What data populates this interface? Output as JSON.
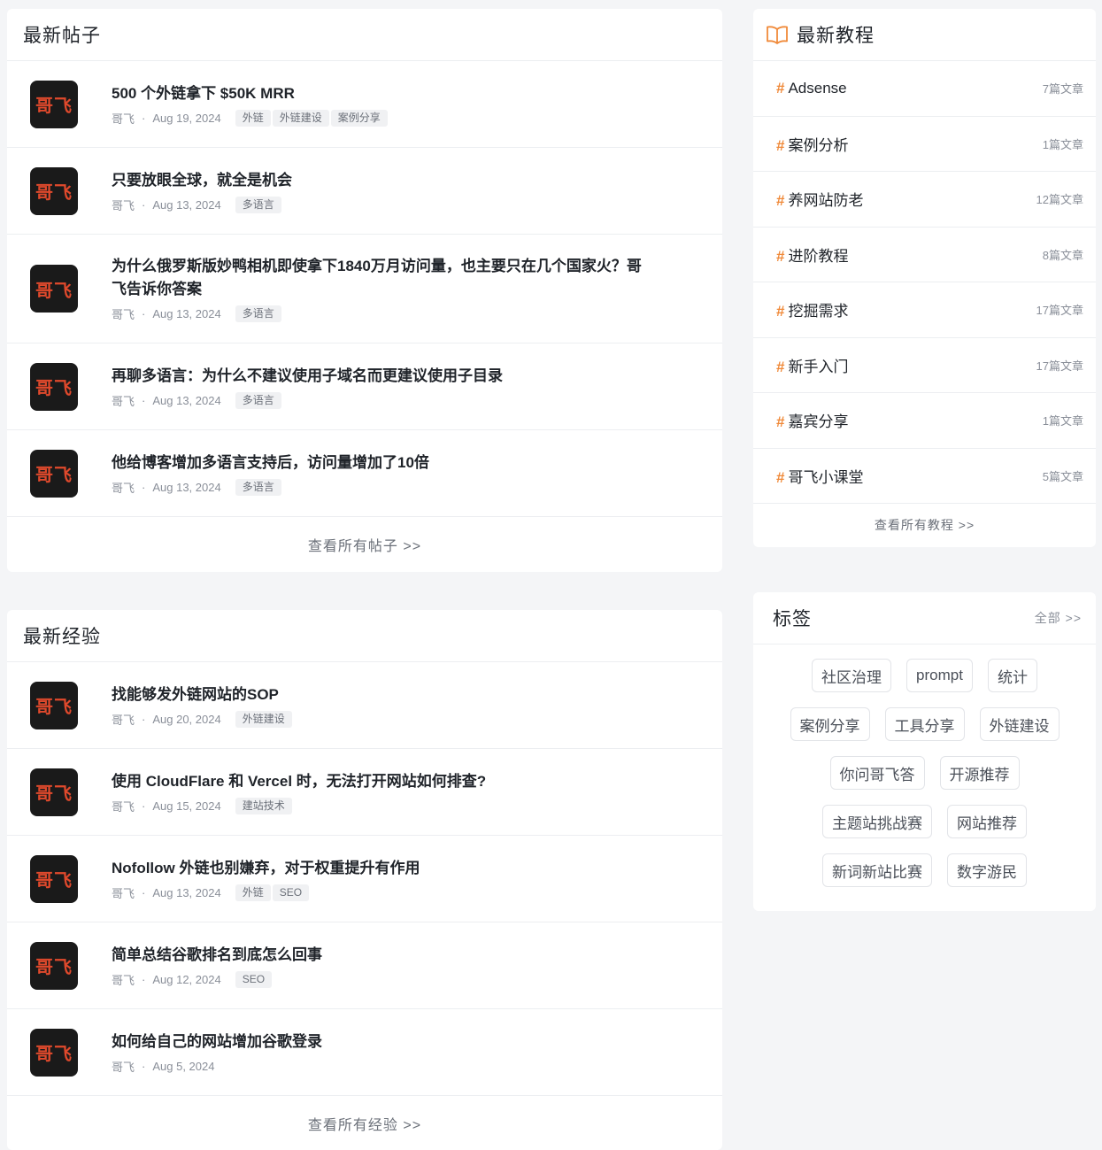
{
  "latest_posts": {
    "title": "最新帖子",
    "see_all": "查看所有帖子 >>",
    "items": [
      {
        "avatar": "哥飞",
        "title": "500 个外链拿下 $50K MRR",
        "author": "哥飞",
        "date": "Aug 19, 2024",
        "tags": [
          "外链",
          "外链建设",
          "案例分享"
        ]
      },
      {
        "avatar": "哥飞",
        "title": "只要放眼全球，就全是机会",
        "author": "哥飞",
        "date": "Aug 13, 2024",
        "tags": [
          "多语言"
        ]
      },
      {
        "avatar": "哥飞",
        "title": "为什么俄罗斯版妙鸭相机即使拿下1840万月访问量，也主要只在几个国家火？哥飞告诉你答案",
        "author": "哥飞",
        "date": "Aug 13, 2024",
        "tags": [
          "多语言"
        ]
      },
      {
        "avatar": "哥飞",
        "title": "再聊多语言：为什么不建议使用子域名而更建议使用子目录",
        "author": "哥飞",
        "date": "Aug 13, 2024",
        "tags": [
          "多语言"
        ]
      },
      {
        "avatar": "哥飞",
        "title": "他给博客增加多语言支持后，访问量增加了10倍",
        "author": "哥飞",
        "date": "Aug 13, 2024",
        "tags": [
          "多语言"
        ]
      }
    ]
  },
  "latest_experience": {
    "title": "最新经验",
    "see_all": "查看所有经验 >>",
    "items": [
      {
        "avatar": "哥飞",
        "title": "找能够发外链网站的SOP",
        "author": "哥飞",
        "date": "Aug 20, 2024",
        "tags": [
          "外链建设"
        ]
      },
      {
        "avatar": "哥飞",
        "title": "使用 CloudFlare 和 Vercel 时，无法打开网站如何排查?",
        "author": "哥飞",
        "date": "Aug 15, 2024",
        "tags": [
          "建站技术"
        ]
      },
      {
        "avatar": "哥飞",
        "title": "Nofollow 外链也别嫌弃，对于权重提升有作用",
        "author": "哥飞",
        "date": "Aug 13, 2024",
        "tags": [
          "外链",
          "SEO"
        ]
      },
      {
        "avatar": "哥飞",
        "title": "简单总结谷歌排名到底怎么回事",
        "author": "哥飞",
        "date": "Aug 12, 2024",
        "tags": [
          "SEO"
        ]
      },
      {
        "avatar": "哥飞",
        "title": "如何给自己的网站增加谷歌登录",
        "author": "哥飞",
        "date": "Aug 5, 2024",
        "tags": []
      }
    ]
  },
  "tutorials": {
    "title": "最新教程",
    "icon": "book-icon",
    "accent": "#f08a3a",
    "see_all": "查看所有教程 >>",
    "items": [
      {
        "hash": "#",
        "name": "Adsense",
        "count": "7篇文章"
      },
      {
        "hash": "#",
        "name": "案例分析",
        "count": "1篇文章"
      },
      {
        "hash": "#",
        "name": "养网站防老",
        "count": "12篇文章"
      },
      {
        "hash": "#",
        "name": "进阶教程",
        "count": "8篇文章"
      },
      {
        "hash": "#",
        "name": "挖掘需求",
        "count": "17篇文章"
      },
      {
        "hash": "#",
        "name": "新手入门",
        "count": "17篇文章"
      },
      {
        "hash": "#",
        "name": "嘉宾分享",
        "count": "1篇文章"
      },
      {
        "hash": "#",
        "name": "哥飞小课堂",
        "count": "5篇文章"
      }
    ]
  },
  "tags_panel": {
    "title": "标签",
    "all_link": "全部 >>",
    "rows": [
      [
        "社区治理",
        "prompt",
        "统计"
      ],
      [
        "案例分享",
        "工具分享",
        "外链建设"
      ],
      [
        "你问哥飞答",
        "开源推荐"
      ],
      [
        "主题站挑战赛",
        "网站推荐"
      ],
      [
        "新词新站比赛",
        "数字游民"
      ]
    ]
  }
}
